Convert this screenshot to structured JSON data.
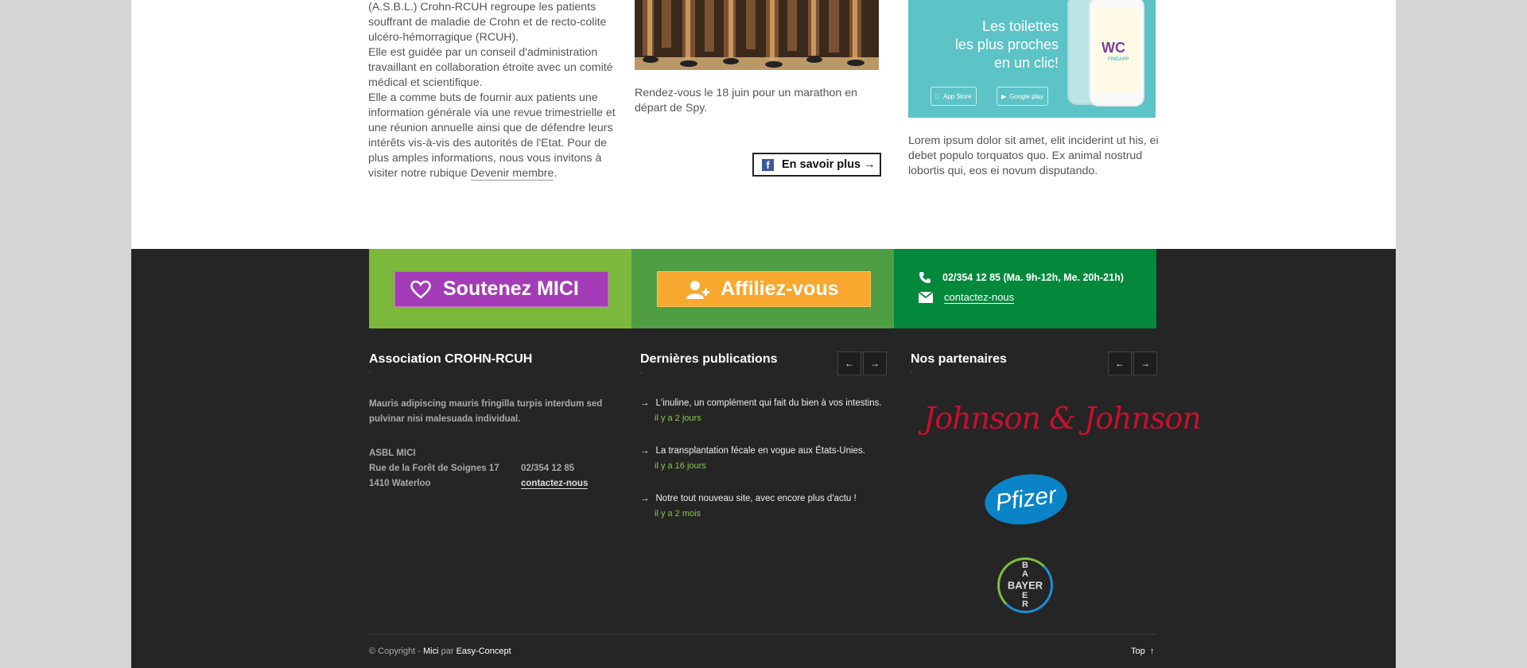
{
  "about": {
    "paragraphs": [
      "(A.S.B.L.) Crohn-RCUH regroupe les patients souffrant de maladie de Crohn et de recto-colite ulcéro-hémorragique (RCUH).",
      "Elle est guidée par un conseil d'administration travaillant en collaboration étroite avec un comité médical et scientifique.",
      "Elle a comme buts de fournir aux patients une information générale via une revue trimestrielle et une réunion annuelle ainsi que de défendre leurs intérêts vis-à-vis des autorités de l'Etat. Pour de plus amples informations, nous vous invitons à visiter notre rubique"
    ],
    "link": "Devenir membre",
    "suffix": "."
  },
  "event": {
    "caption": "Rendez-vous le 18 juin pour un marathon en départ de Spy.",
    "more_button": "En savoir plus →"
  },
  "wc_ad": {
    "line1": "Les toilettes",
    "line2": "les plus proches",
    "line3": "en un clic!",
    "app_name": "WC",
    "app_sub": "FINDAPP",
    "appstore": "App Store",
    "googleplay": "Google play",
    "text": "Lorem ipsum dolor sit amet, elit inciderint ut his, ei debet populo torquatos quo. Ex animal nostrud lobortis qui, eos ei novum disputando."
  },
  "cta": {
    "support": "Soutenez MICI",
    "join": "Affiliez-vous",
    "phone": "02/354 12 85 (Ma. 9h-12h, Me. 20h-21h)",
    "contact": "contactez-nous"
  },
  "footer": {
    "assoc_title": "Association CROHN-RCUH",
    "assoc_desc": "Mauris adipiscing mauris fringilla turpis interdum sed pulvinar nisi malesuada individual.",
    "address": [
      "ASBL MICI",
      "Rue de la Forêt de Soignes 17",
      "1410 Waterloo"
    ],
    "phone": "02/354 12 85",
    "contact": "contactez-nous",
    "pubs_title": "Dernières publications",
    "pubs": [
      {
        "title": "L'inuline, un complément qui fait du bien à vos intestins.",
        "date": "il y a 2 jours"
      },
      {
        "title": "La transplantation fécale en vogue aux États-Unies.",
        "date": "il y a 16 jours"
      },
      {
        "title": "Notre tout nouveau site, avec encore plus d'actu !",
        "date": "il y a 2 mois"
      }
    ],
    "partners_title": "Nos partenaires",
    "partners": [
      "Johnson & Johnson",
      "Pfizer",
      "BAYER"
    ],
    "prev": "←",
    "next": "→",
    "copyright_prefix": "© Copyright - ",
    "copyright_site": "Mici",
    "copyright_by": " par ",
    "copyright_agency": "Easy-Concept",
    "top": "Top"
  }
}
